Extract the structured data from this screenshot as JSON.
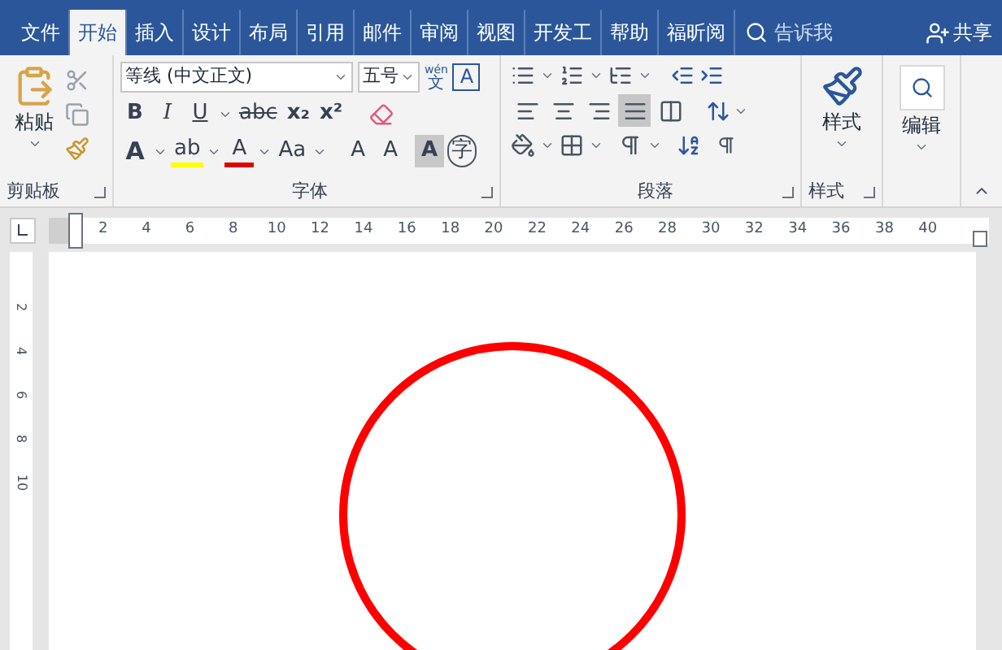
{
  "tabs": [
    {
      "label": "文件",
      "selected": false
    },
    {
      "label": "开始",
      "selected": true
    },
    {
      "label": "插入",
      "selected": false
    },
    {
      "label": "设计",
      "selected": false
    },
    {
      "label": "布局",
      "selected": false
    },
    {
      "label": "引用",
      "selected": false
    },
    {
      "label": "邮件",
      "selected": false
    },
    {
      "label": "审阅",
      "selected": false
    },
    {
      "label": "视图",
      "selected": false
    },
    {
      "label": "开发工",
      "selected": false
    },
    {
      "label": "帮助",
      "selected": false
    },
    {
      "label": "福昕阅",
      "selected": false
    }
  ],
  "tell_me": "告诉我",
  "share": "共享",
  "clipboard": {
    "paste": "粘贴",
    "label": "剪贴板"
  },
  "font": {
    "name": "等线 (中文正文)",
    "size": "五号",
    "phonetic_top": "wén",
    "phonetic_bottom": "文",
    "border_char": "A",
    "effects": "A",
    "bold": "B",
    "italic": "I",
    "underline": "U",
    "strike": "abc",
    "subscript": "x₂",
    "superscript": "x²",
    "highlight": "ab",
    "color_char": "A",
    "case": "Aa",
    "grow": "A",
    "shrink": "A",
    "shading": "A",
    "enclose": "字",
    "label": "字体"
  },
  "paragraph": {
    "label": "段落",
    "alignments": [
      {
        "selected": false
      },
      {
        "selected": false
      },
      {
        "selected": false
      },
      {
        "selected": true
      },
      {
        "selected": false
      }
    ]
  },
  "styles": {
    "button": "样式",
    "label": "样式"
  },
  "editing": {
    "button": "编辑"
  },
  "ruler": [
    "2",
    "4",
    "6",
    "8",
    "10",
    "12",
    "14",
    "16",
    "18",
    "20",
    "22",
    "24",
    "26",
    "28",
    "30",
    "32",
    "34",
    "36",
    "38",
    "40"
  ],
  "vertical_ruler": [
    "2",
    "4",
    "6",
    "8",
    "10"
  ]
}
